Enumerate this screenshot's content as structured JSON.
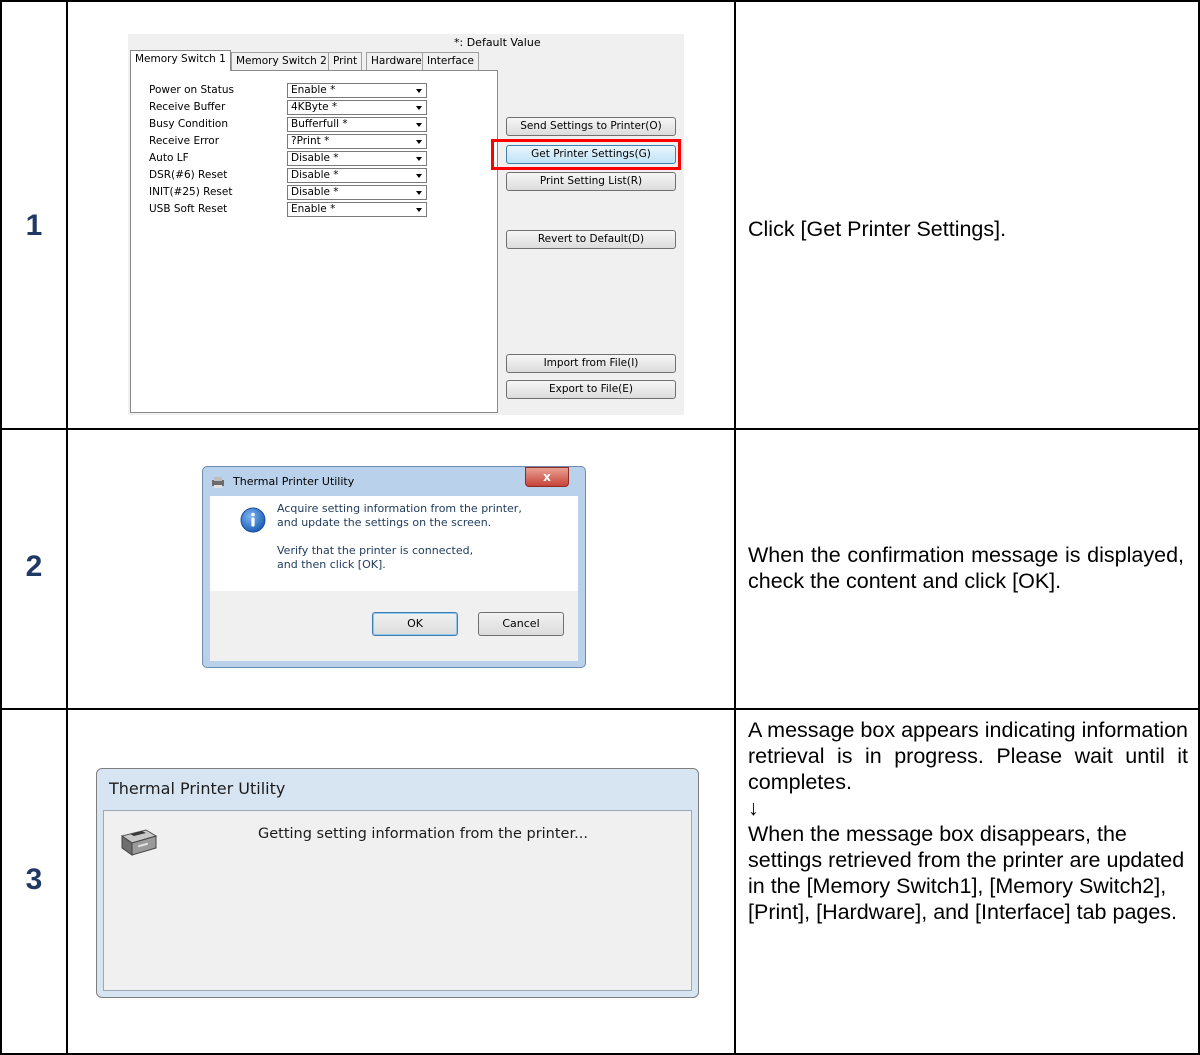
{
  "steps": [
    {
      "number": "1",
      "description": "Click [Get Printer Settings]."
    },
    {
      "number": "2",
      "description": "When the confirmation message is displayed, check the content and click [OK]."
    },
    {
      "number": "3",
      "description_lines": [
        "A message box appears indicating information retrieval is in progress. Please wait until it completes.",
        "↓",
        "When the message box disappears, the settings retrieved from the printer are updated in the [Memory Switch1], [Memory Switch2], [Print], [Hardware], and [Interface] tab pages."
      ]
    }
  ],
  "settings_screen": {
    "default_note": "*: Default Value",
    "tabs": [
      "Memory Switch 1",
      "Memory Switch 2",
      "Print",
      "Hardware",
      "Interface"
    ],
    "active_tab": "Memory Switch 1",
    "settings": [
      {
        "label": "Power on Status",
        "value": "Enable *"
      },
      {
        "label": "Receive Buffer",
        "value": "4KByte *"
      },
      {
        "label": "Busy Condition",
        "value": "Bufferfull *"
      },
      {
        "label": "Receive Error",
        "value": "?Print *"
      },
      {
        "label": "Auto LF",
        "value": "Disable *"
      },
      {
        "label": "DSR(#6) Reset",
        "value": "Disable *"
      },
      {
        "label": "INIT(#25) Reset",
        "value": "Disable *"
      },
      {
        "label": "USB Soft Reset",
        "value": "Enable *"
      }
    ],
    "buttons": {
      "send": "Send Settings to Printer(O)",
      "get": "Get Printer Settings(G)",
      "print_list": "Print Setting List(R)",
      "revert": "Revert to Default(D)",
      "import": "Import from File(I)",
      "export": "Export to File(E)"
    },
    "highlight_color": "#ff0000"
  },
  "confirm_dialog": {
    "title": "Thermal Printer Utility",
    "close_symbol": "x",
    "message_lines": [
      "Acquire setting information from the printer,",
      "and update the settings on the screen.",
      "",
      "Verify that the printer is connected,",
      "and then click [OK]."
    ],
    "ok_label": "OK",
    "cancel_label": "Cancel",
    "icon": "info-icon"
  },
  "progress_dialog": {
    "title": "Thermal Printer Utility",
    "message": "Getting setting information from the printer...",
    "icon": "printer-icon"
  }
}
